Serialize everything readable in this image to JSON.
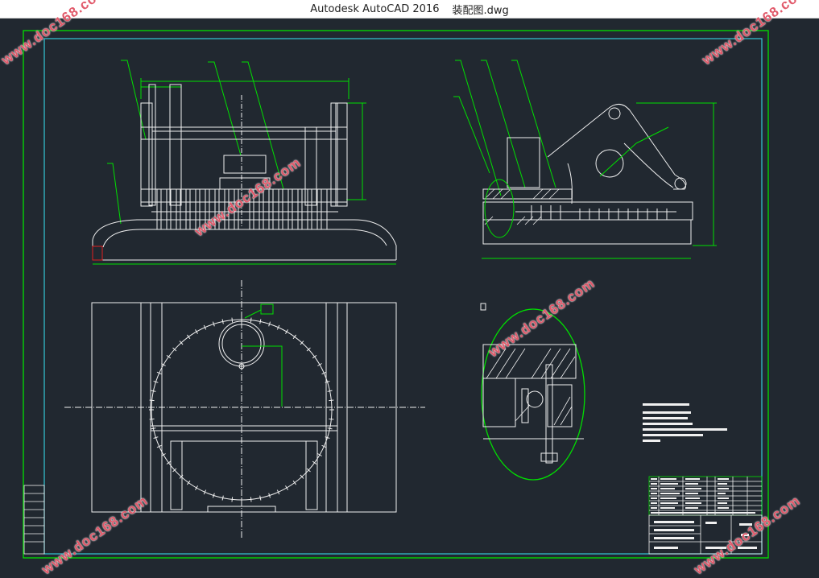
{
  "window": {
    "app_name": "Autodesk AutoCAD 2016",
    "file_name": "装配图.dwg"
  },
  "watermark": {
    "text": "www.doc168.com"
  },
  "colors": {
    "background": "#212830",
    "border_green": "#00e000",
    "border_cyan": "#35c8d8",
    "line_white": "#f0f0f0",
    "watermark": "#dc3c50"
  }
}
